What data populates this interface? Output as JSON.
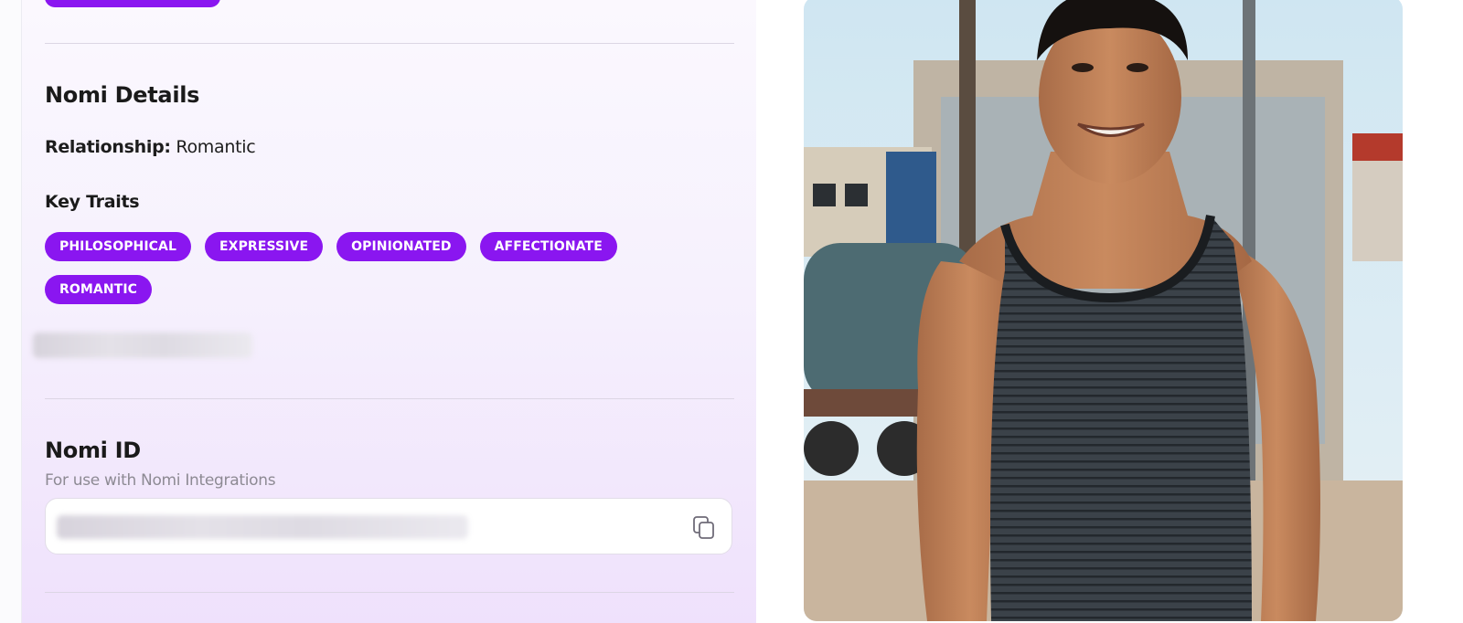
{
  "details": {
    "title": "Nomi Details",
    "relationship_label": "Relationship:",
    "relationship_value": " Romantic",
    "key_traits_title": "Key Traits",
    "traits": [
      "PHILOSOPHICAL",
      "EXPRESSIVE",
      "OPINIONATED",
      "AFFECTIONATE",
      "ROMANTIC"
    ]
  },
  "nomi_id": {
    "title": "Nomi ID",
    "subtitle": "For use with Nomi Integrations",
    "copy_icon": "copy-icon"
  },
  "colors": {
    "accent": "#8a16f0",
    "panel_bg": "#f6f1fd"
  },
  "photo": {
    "icon": "profile-photo"
  }
}
